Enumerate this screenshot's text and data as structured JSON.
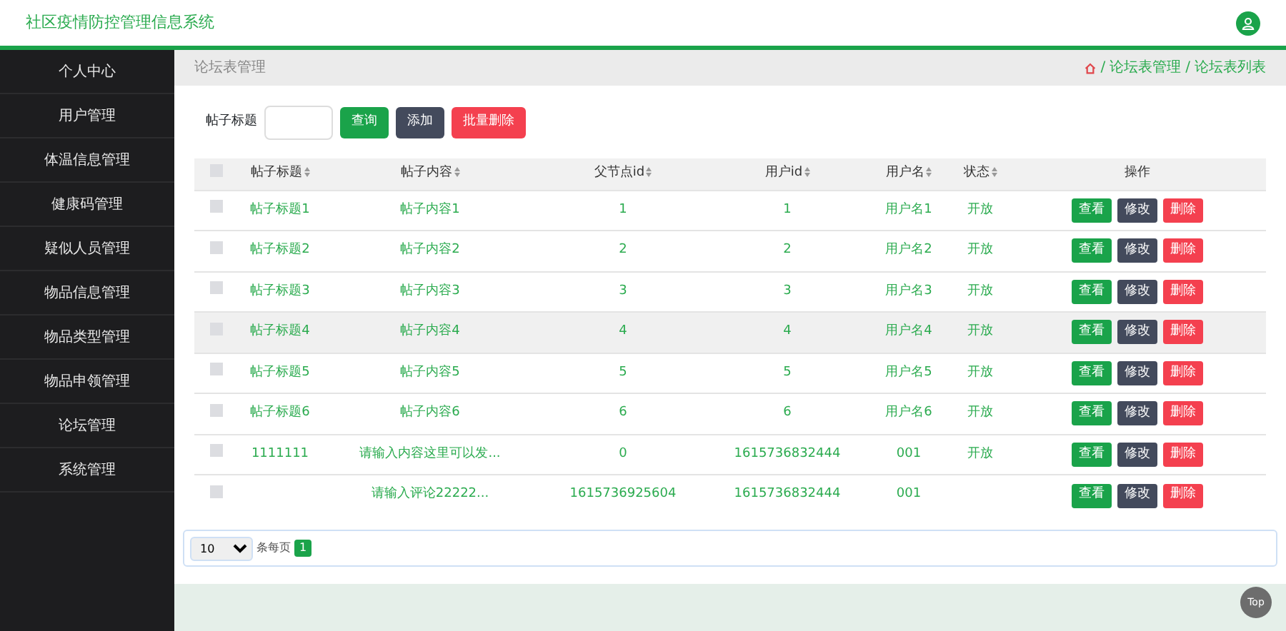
{
  "header": {
    "title": "社区疫情防控管理信息系统"
  },
  "sidebar": {
    "items": [
      {
        "label": "个人中心"
      },
      {
        "label": "用户管理"
      },
      {
        "label": "体温信息管理"
      },
      {
        "label": "健康码管理"
      },
      {
        "label": "疑似人员管理"
      },
      {
        "label": "物品信息管理"
      },
      {
        "label": "物品类型管理"
      },
      {
        "label": "物品申领管理"
      },
      {
        "label": "论坛管理"
      },
      {
        "label": "系统管理"
      }
    ]
  },
  "page_title": "论坛表管理",
  "breadcrumb": [
    {
      "separator": "/",
      "label": "论坛表管理"
    },
    {
      "separator": "/",
      "label": "论坛表列表"
    }
  ],
  "search": {
    "label": "帖子标题",
    "buttons": [
      {
        "label": "查询",
        "kind": "success"
      },
      {
        "label": "添加",
        "kind": "dark"
      },
      {
        "label": "批量删除",
        "kind": "danger"
      }
    ]
  },
  "table": {
    "select_all_checked": false,
    "columns": [
      "帖子标题",
      "帖子内容",
      "父节点id",
      "用户id",
      "用户名",
      "状态",
      "操作"
    ],
    "rows": [
      {
        "checked": false,
        "hovered": false,
        "title": "帖子标题1",
        "content": "帖子内容1",
        "parent_id": "1",
        "user_id": "1",
        "username": "用户名1",
        "status": "开放",
        "actions": [
          {
            "label": "查看",
            "kind": "success"
          },
          {
            "label": "修改",
            "kind": "dark"
          },
          {
            "label": "删除",
            "kind": "danger"
          }
        ]
      },
      {
        "checked": false,
        "hovered": false,
        "title": "帖子标题2",
        "content": "帖子内容2",
        "parent_id": "2",
        "user_id": "2",
        "username": "用户名2",
        "status": "开放",
        "actions": [
          {
            "label": "查看",
            "kind": "success"
          },
          {
            "label": "修改",
            "kind": "dark"
          },
          {
            "label": "删除",
            "kind": "danger"
          }
        ]
      },
      {
        "checked": false,
        "hovered": false,
        "title": "帖子标题3",
        "content": "帖子内容3",
        "parent_id": "3",
        "user_id": "3",
        "username": "用户名3",
        "status": "开放",
        "actions": [
          {
            "label": "查看",
            "kind": "success"
          },
          {
            "label": "修改",
            "kind": "dark"
          },
          {
            "label": "删除",
            "kind": "danger"
          }
        ]
      },
      {
        "checked": false,
        "hovered": true,
        "title": "帖子标题4",
        "content": "帖子内容4",
        "parent_id": "4",
        "user_id": "4",
        "username": "用户名4",
        "status": "开放",
        "actions": [
          {
            "label": "查看",
            "kind": "success"
          },
          {
            "label": "修改",
            "kind": "dark"
          },
          {
            "label": "删除",
            "kind": "danger"
          }
        ]
      },
      {
        "checked": false,
        "hovered": false,
        "title": "帖子标题5",
        "content": "帖子内容5",
        "parent_id": "5",
        "user_id": "5",
        "username": "用户名5",
        "status": "开放",
        "actions": [
          {
            "label": "查看",
            "kind": "success"
          },
          {
            "label": "修改",
            "kind": "dark"
          },
          {
            "label": "删除",
            "kind": "danger"
          }
        ]
      },
      {
        "checked": false,
        "hovered": false,
        "title": "帖子标题6",
        "content": "帖子内容6",
        "parent_id": "6",
        "user_id": "6",
        "username": "用户名6",
        "status": "开放",
        "actions": [
          {
            "label": "查看",
            "kind": "success"
          },
          {
            "label": "修改",
            "kind": "dark"
          },
          {
            "label": "删除",
            "kind": "danger"
          }
        ]
      },
      {
        "checked": false,
        "hovered": false,
        "title": "1111111",
        "content": "请输入内容这里可以发...",
        "parent_id": "0",
        "user_id": "1615736832444",
        "username": "001",
        "status": "开放",
        "actions": [
          {
            "label": "查看",
            "kind": "success"
          },
          {
            "label": "修改",
            "kind": "dark"
          },
          {
            "label": "删除",
            "kind": "danger"
          }
        ]
      },
      {
        "checked": false,
        "hovered": false,
        "content": "请输入评论22222...",
        "parent_id": "1615736925604",
        "user_id": "1615736832444",
        "username": "001",
        "actions": [
          {
            "label": "查看",
            "kind": "success"
          },
          {
            "label": "修改",
            "kind": "dark"
          },
          {
            "label": "删除",
            "kind": "danger"
          }
        ]
      }
    ]
  },
  "pagination": {
    "page_size": "10",
    "page_size_label": "条每页",
    "pages": [
      {
        "label": "1",
        "selected": true
      }
    ]
  },
  "back_to_top": "Top"
}
